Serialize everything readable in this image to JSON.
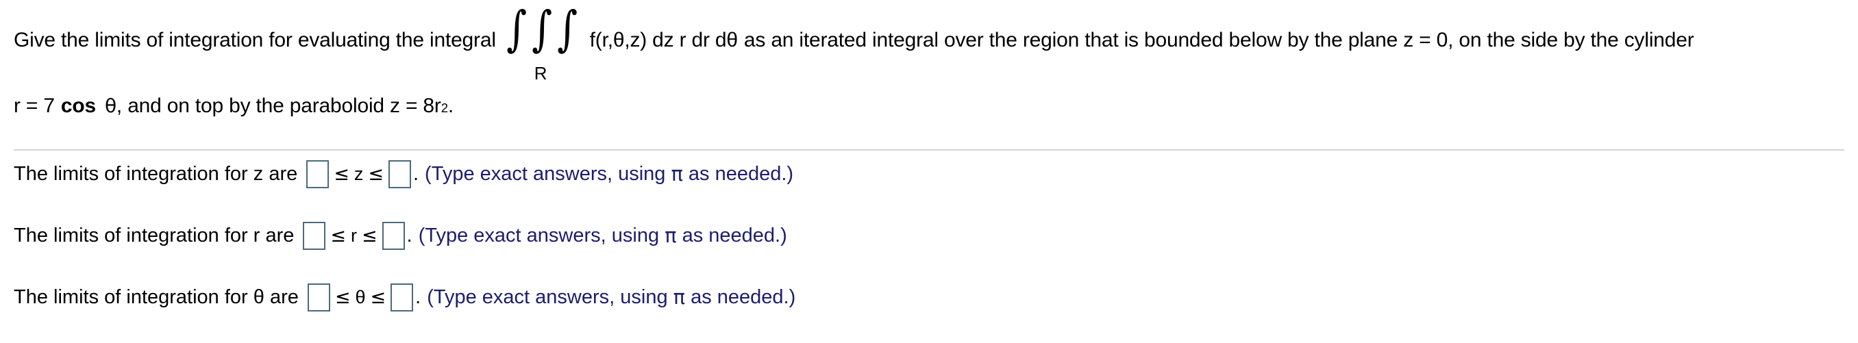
{
  "question": {
    "line1_part1": "Give the limits of integration for evaluating the integral",
    "integral_symbol": "∫",
    "integral_count": 3,
    "integral_subscript": "R",
    "integrand": "f(r,θ,z) dz r dr dθ",
    "line1_part2": "as an iterated integral over the region that is bounded below by the plane z = 0, on the side by the cylinder",
    "line2_cylinder_prefix": "r = 7",
    "line2_cylinder_op": "cos",
    "line2_cylinder_theta": "θ",
    "line2_part2": ", and on top by the paraboloid z = 8r",
    "line2_exponent": "2",
    "line2_period": "."
  },
  "answers": [
    {
      "label": "The limits of integration for z are",
      "variable": "z",
      "lower_value": "",
      "upper_value": "",
      "relation": "≤",
      "period": ".",
      "hint_prefix": "(Type exact answers, using",
      "hint_symbol": "π",
      "hint_suffix": "as needed.)"
    },
    {
      "label": "The limits of integration for r are",
      "variable": "r",
      "lower_value": "",
      "upper_value": "",
      "relation": "≤",
      "period": ".",
      "hint_prefix": "(Type exact answers, using",
      "hint_symbol": "π",
      "hint_suffix": "as needed.)"
    },
    {
      "label": "The limits of integration for θ are",
      "variable": "θ",
      "lower_value": "",
      "upper_value": "",
      "relation": "≤",
      "period": ".",
      "hint_prefix": "(Type exact answers, using",
      "hint_symbol": "π",
      "hint_suffix": "as needed.)"
    }
  ],
  "colors": {
    "text": "#000000",
    "hint_blue": "#1c1c6e",
    "box_border": "#4a6b7c",
    "divider": "#d4d4d4",
    "background": "#ffffff"
  }
}
